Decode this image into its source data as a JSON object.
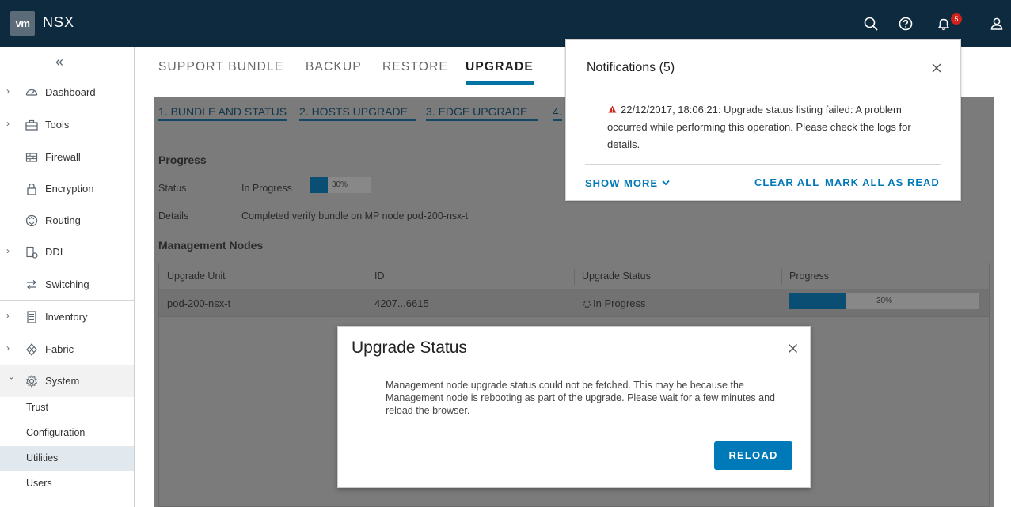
{
  "header": {
    "logo": "vm",
    "app_name": "NSX",
    "notification_count": "5",
    "icons": [
      "search-icon",
      "help-icon",
      "bell-icon",
      "user-icon"
    ]
  },
  "sidebar": {
    "items": [
      {
        "label": "Dashboard",
        "icon": "dashboard-icon",
        "expandable": true
      },
      {
        "label": "Tools",
        "icon": "toolbox-icon",
        "expandable": true
      },
      {
        "label": "Firewall",
        "icon": "firewall-icon",
        "expandable": false
      },
      {
        "label": "Encryption",
        "icon": "lock-icon",
        "expandable": false
      },
      {
        "label": "Routing",
        "icon": "routing-icon",
        "expandable": false
      },
      {
        "label": "DDI",
        "icon": "ddi-icon",
        "expandable": true
      },
      {
        "label": "Switching",
        "icon": "switching-icon",
        "expandable": false
      },
      {
        "label": "Inventory",
        "icon": "inventory-icon",
        "expandable": true
      },
      {
        "label": "Fabric",
        "icon": "fabric-icon",
        "expandable": true
      },
      {
        "label": "System",
        "icon": "system-gear-icon",
        "expandable": true,
        "expanded": true
      }
    ],
    "system_children": [
      "Trust",
      "Configuration",
      "Utilities",
      "Users"
    ],
    "active_child": "Utilities"
  },
  "tabs": [
    "SUPPORT BUNDLE",
    "BACKUP",
    "RESTORE",
    "UPGRADE"
  ],
  "active_tab": "UPGRADE",
  "steps": [
    "1. BUNDLE AND STATUS",
    "2. HOSTS UPGRADE",
    "3. EDGE UPGRADE",
    "4."
  ],
  "progress": {
    "title": "Progress",
    "status_label": "Status",
    "status_value": "In Progress",
    "percent": 30,
    "percent_text": "30%",
    "details_label": "Details",
    "details_value": "Completed verify bundle on MP node pod-200-nsx-t"
  },
  "management_nodes": {
    "title": "Management Nodes",
    "columns": [
      "Upgrade Unit",
      "ID",
      "Upgrade Status",
      "Progress"
    ],
    "rows": [
      {
        "unit": "pod-200-nsx-t",
        "id": "4207...6615",
        "status": "In Progress",
        "percent": 30,
        "percent_text": "30%"
      }
    ]
  },
  "notifications": {
    "title": "Notifications (5)",
    "message": "22/12/2017, 18:06:21: Upgrade status listing failed: A problem occurred while performing this operation. Please check the logs for details.",
    "show_more": "SHOW MORE",
    "clear_all": "CLEAR ALL",
    "mark_all_read": "MARK ALL AS READ",
    "colors": {
      "link": "#0079b8",
      "warning": "#d0211b"
    }
  },
  "modal": {
    "title": "Upgrade Status",
    "body": "Management node upgrade status could not be fetched. This may be because the Management node is rebooting as part of the upgrade. Please wait for a few minutes and reload the browser.",
    "button": "RELOAD"
  }
}
